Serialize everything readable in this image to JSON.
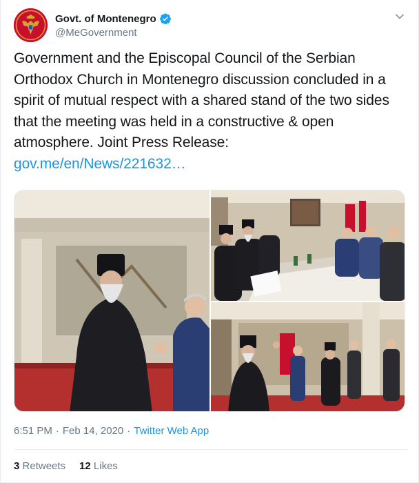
{
  "account": {
    "display_name": "Govt. of Montenegro",
    "handle": "@MeGovernment",
    "avatar_icon": "montenegro-coat-of-arms",
    "verified_icon": "verified-badge-icon"
  },
  "tweet": {
    "text": "Government and the Episcopal Council of the Serbian Orthodox Church in Montenegro discussion concluded in a spirit of mutual respect with a shared stand of the two sides that the meeting was held in a constructive & open atmosphere. Joint Press Release:",
    "link": "gov.me/en/News/221632…"
  },
  "timestamp": {
    "time": "6:51 PM",
    "date": "Feb 14, 2020",
    "separator": "·",
    "source": "Twitter Web App"
  },
  "stats": {
    "retweets_count": "3",
    "retweets_label": "Retweets",
    "likes_count": "12",
    "likes_label": "Likes"
  },
  "colors": {
    "link": "#1b95e0",
    "muted": "#657786",
    "text": "#14171a",
    "avatar_bg": "#c8102e"
  }
}
